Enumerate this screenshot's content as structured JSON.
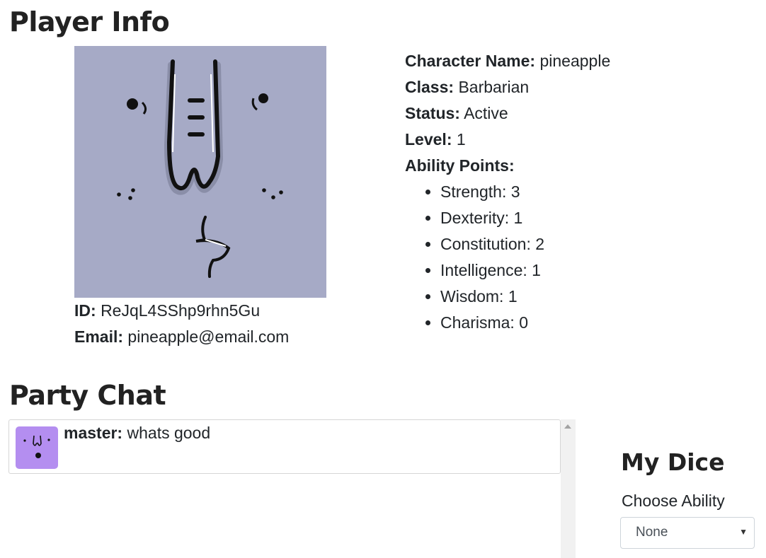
{
  "player_info": {
    "title": "Player Info",
    "id_label": "ID:",
    "id_value": "ReJqL4SShp9rhn5Gu",
    "email_label": "Email:",
    "email_value": "pineapple@email.com",
    "character_name_label": "Character Name:",
    "character_name": "pineapple",
    "class_label": "Class:",
    "class": "Barbarian",
    "status_label": "Status:",
    "status": "Active",
    "level_label": "Level:",
    "level": "1",
    "ability_points_label": "Ability Points:",
    "abilities": [
      "Strength: 3",
      "Dexterity: 1",
      "Constitution: 2",
      "Intelligence: 1",
      "Wisdom: 1",
      "Charisma: 0"
    ]
  },
  "party_chat": {
    "title": "Party Chat",
    "messages": [
      {
        "sender": "master:",
        "text": "whats good"
      }
    ]
  },
  "dice": {
    "title": "My Dice",
    "choose_label": "Choose Ability",
    "selected": "None"
  },
  "colors": {
    "avatar_bg": "#a6aac6",
    "chat_avatar_bg": "#b48ef0"
  }
}
